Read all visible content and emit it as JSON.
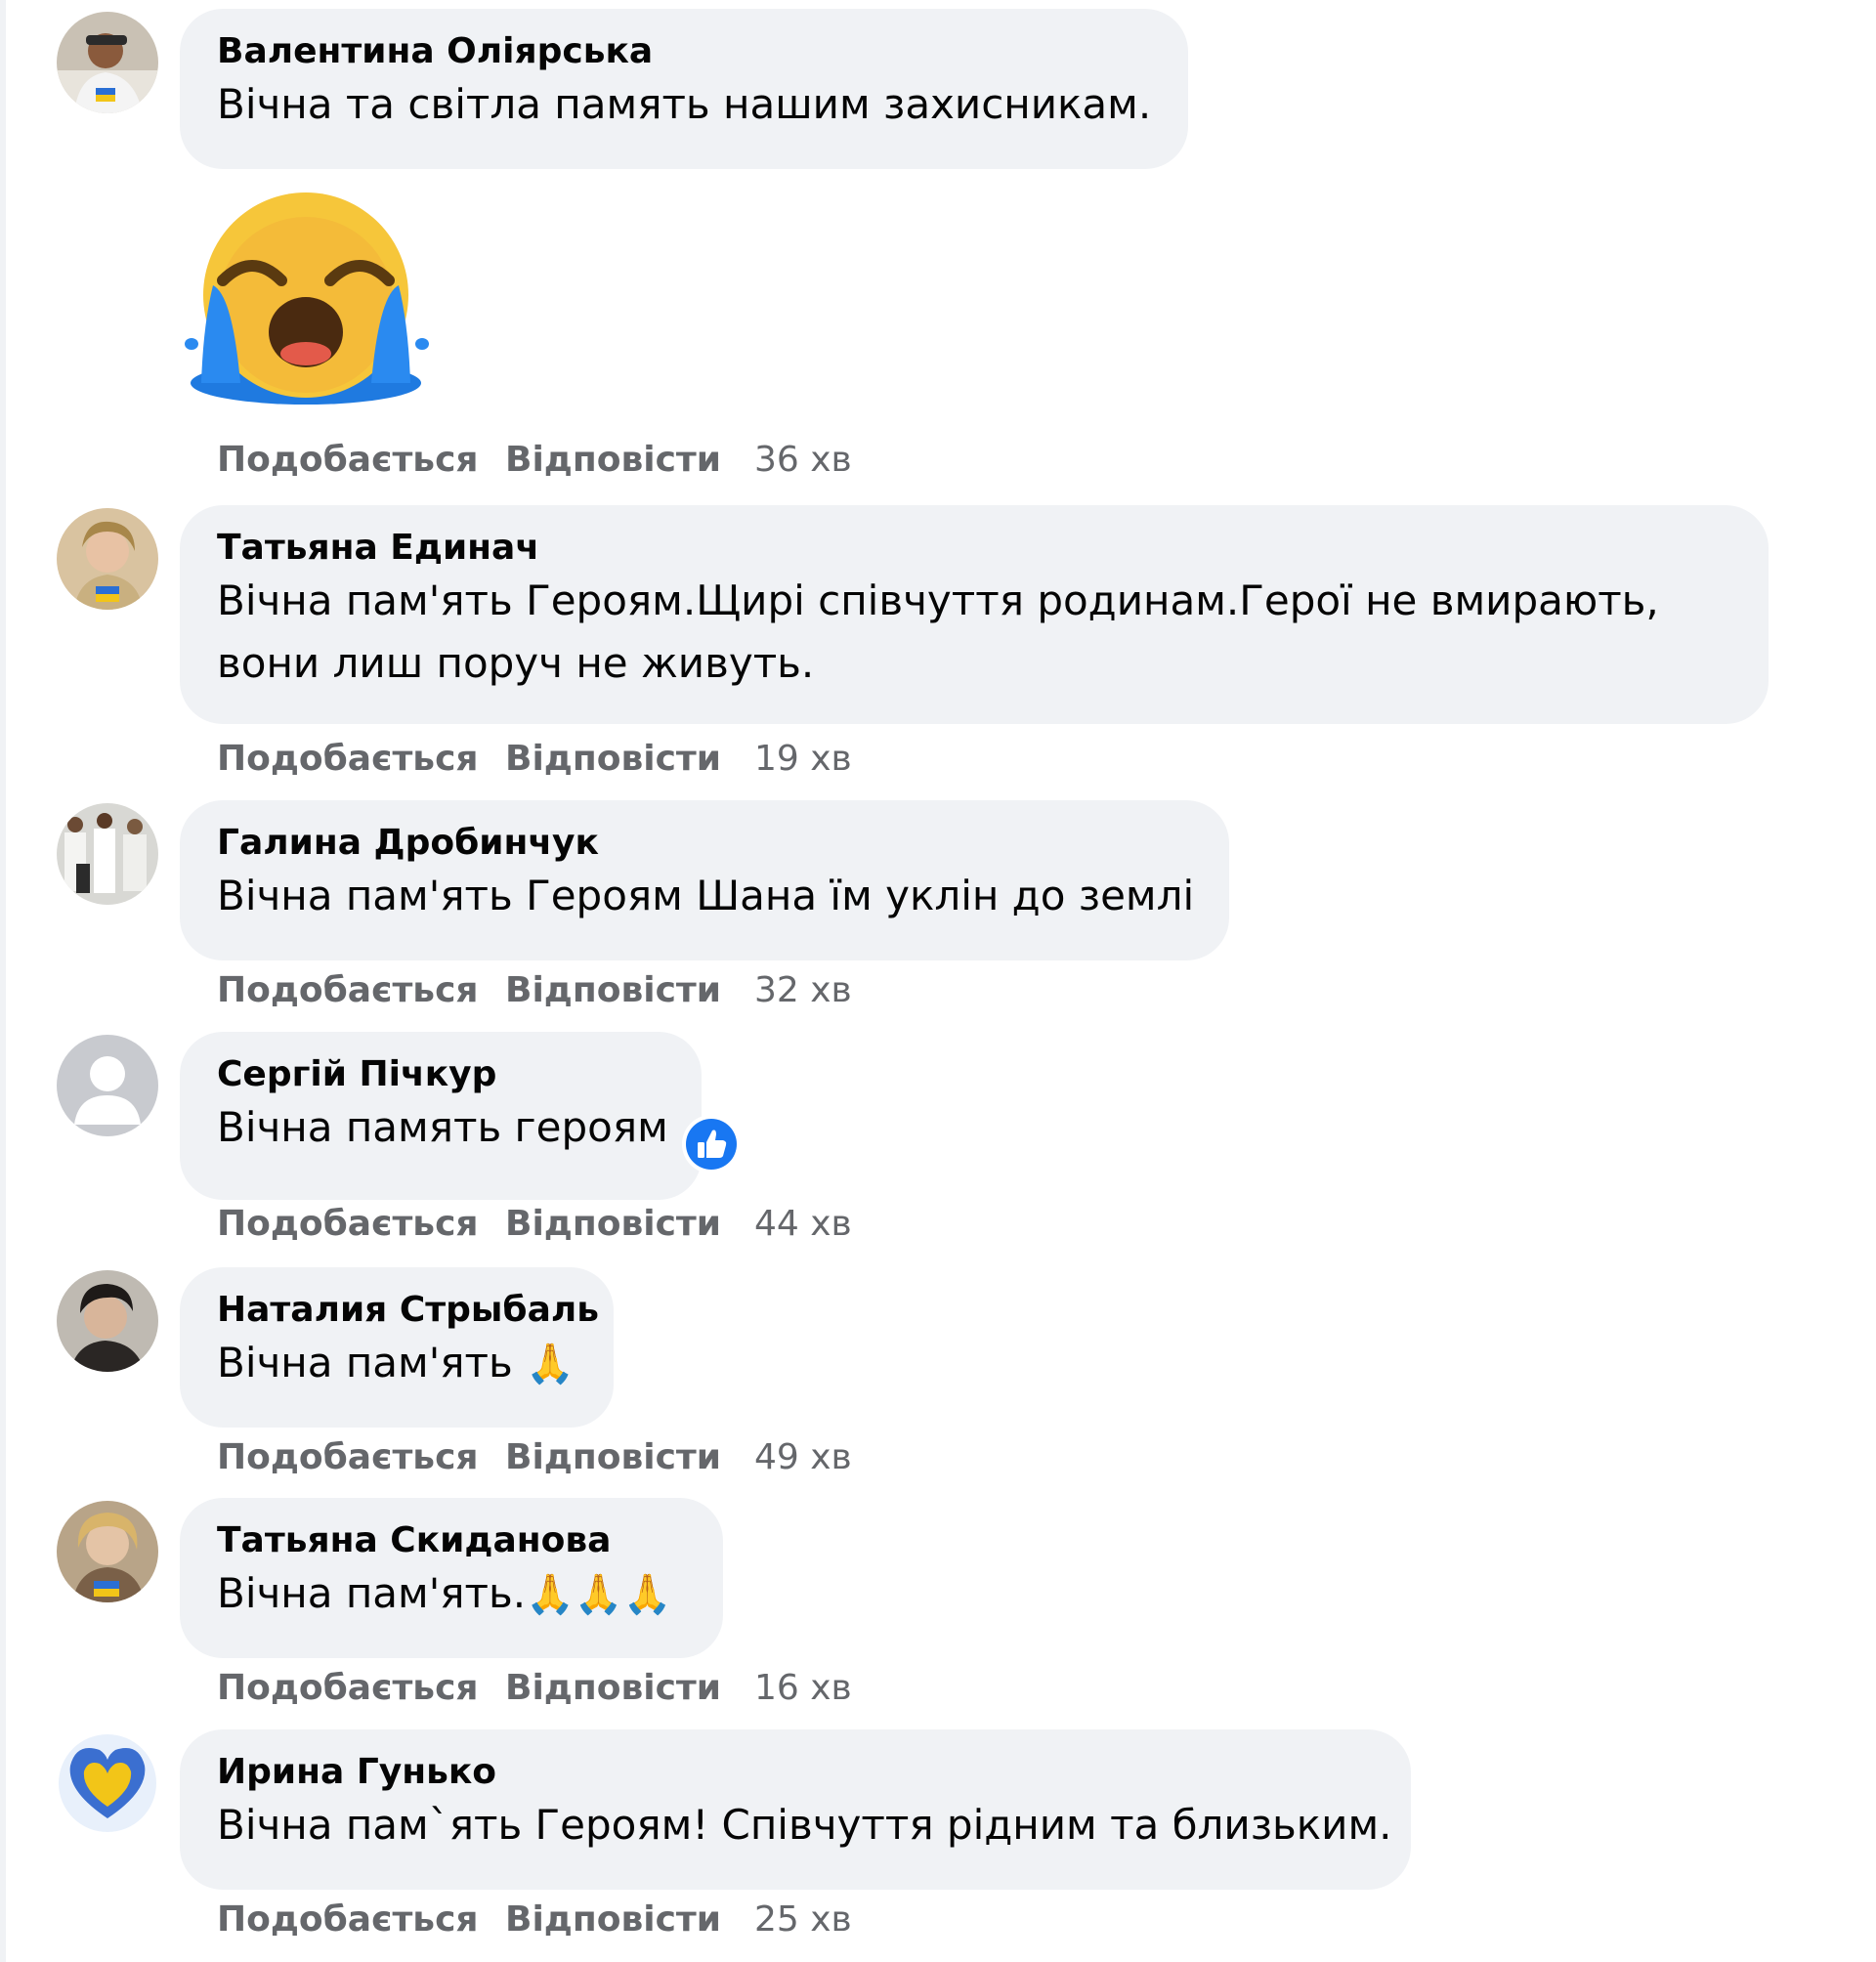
{
  "actions": {
    "like": "Подобається",
    "reply": "Відповісти"
  },
  "comments": [
    {
      "author": "Валентина Оліярська",
      "text": "Вічна та світла память нашим захисникам.",
      "time": "36 хв",
      "avatar": "avatar-photo",
      "sticker": "crying-face-sticker"
    },
    {
      "author": "Татьяна Единач",
      "text_line1": "Вічна пам'ять Героям.Щирі співчуття родинам.Герої не вмирають,",
      "text_line2": "вони лиш поруч не живуть.",
      "time": "19 хв",
      "avatar": "avatar-photo"
    },
    {
      "author": "Галина Дробинчук",
      "text": "Вічна пам'ять Героям Шана їм уклін до землі",
      "time": "32 хв",
      "avatar": "avatar-photo"
    },
    {
      "author": "Сергій Пічкур",
      "text": "Вічна память героям",
      "time": "44 хв",
      "avatar": "default-avatar",
      "reaction": "like-reaction-icon"
    },
    {
      "author": "Наталия Стрыбаль",
      "text": "Вічна пам'ять",
      "emoji": "🙏",
      "time": "49 хв",
      "avatar": "avatar-photo"
    },
    {
      "author": "Татьяна Скиданова",
      "text": "Вічна пам'ять.",
      "emoji": "🙏🙏🙏",
      "time": "16 хв",
      "avatar": "avatar-photo"
    },
    {
      "author": "Ирина Гунько",
      "text": "Вічна пам`ять Героям! Співчуття рідним та близьким.",
      "time": "25 хв",
      "avatar": "heart-avatar"
    }
  ],
  "colors": {
    "bubble": "#f0f2f5",
    "meta": "#65676b",
    "text": "#050505",
    "like_blue": "#1877f2"
  }
}
